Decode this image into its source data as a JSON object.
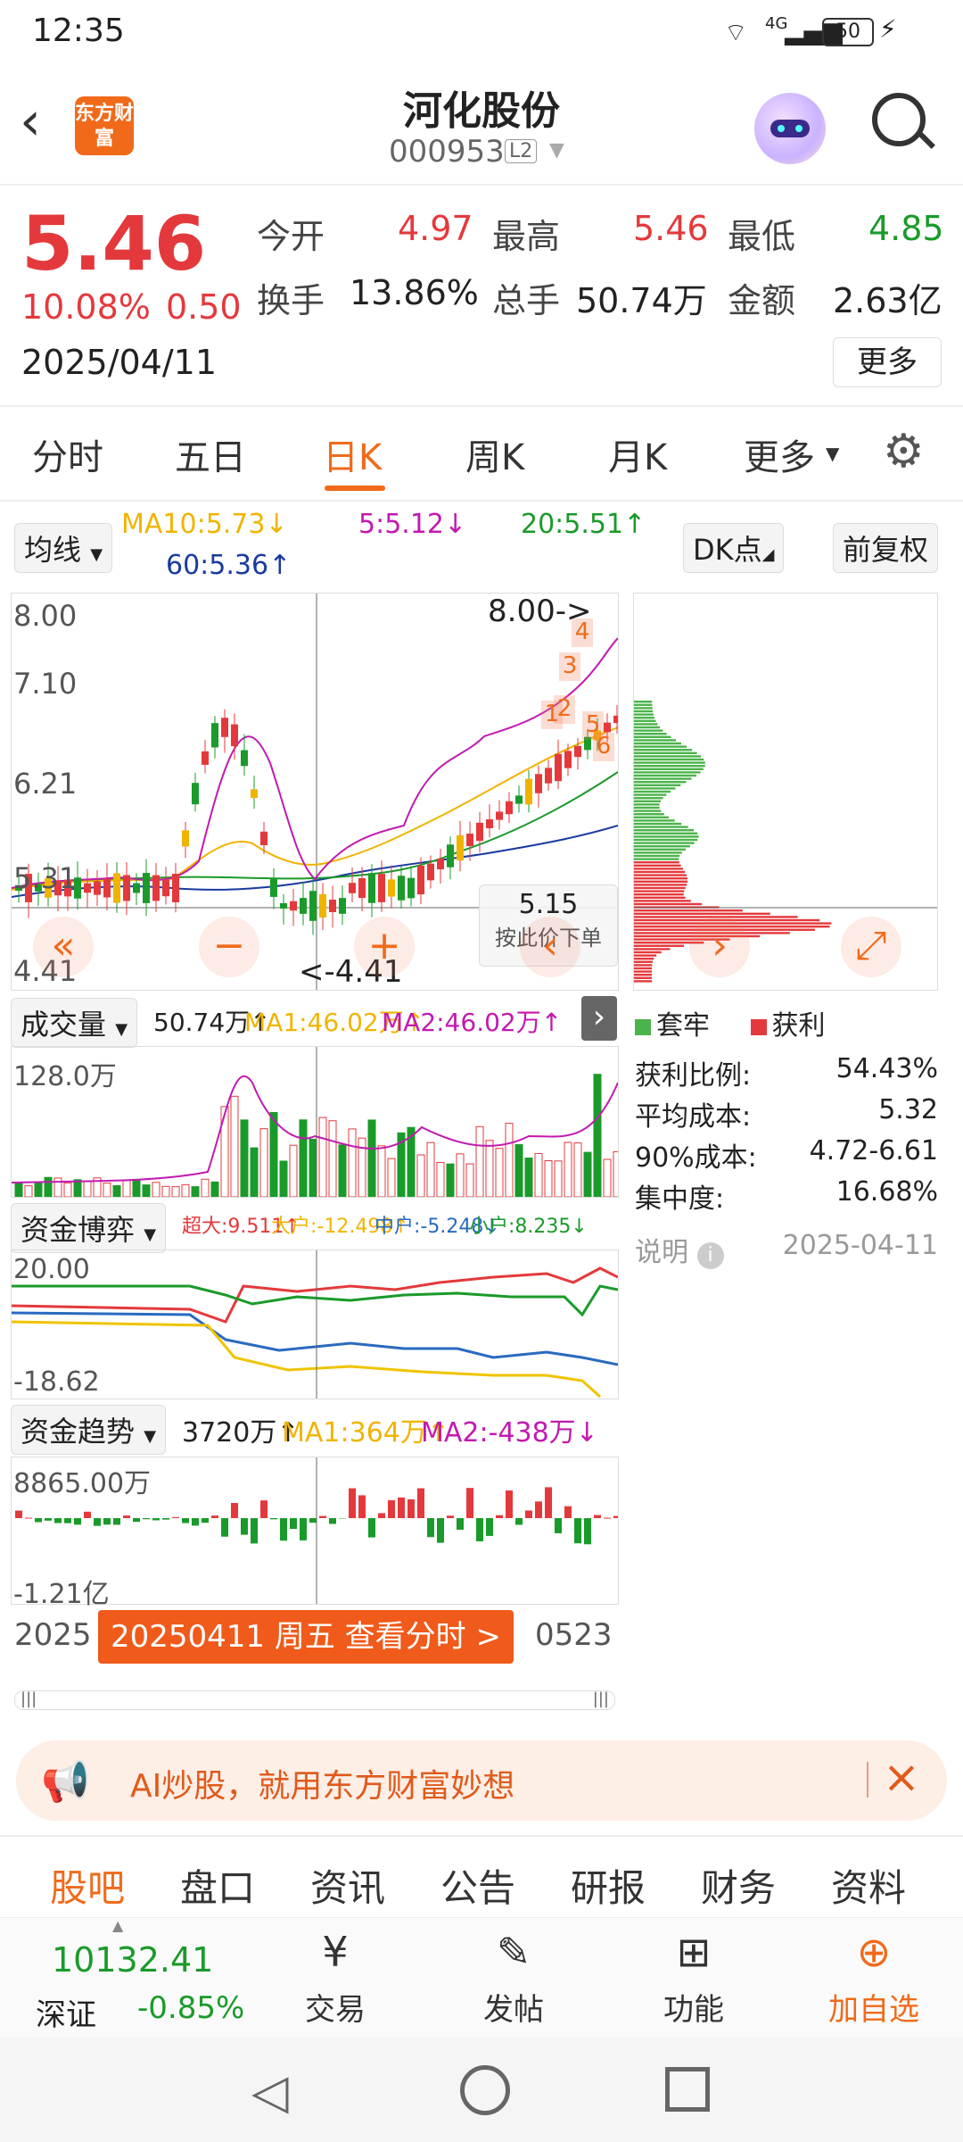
{
  "status_bar": {
    "time": "12:35",
    "network": "4G",
    "battery": "50"
  },
  "header": {
    "stock_name": "河化股份",
    "stock_code": "000953",
    "level_badge": "L2",
    "logo_text": "东方财富"
  },
  "quote": {
    "price": "5.46",
    "change_pct": "10.08%",
    "change": "0.50",
    "date": "2025/04/11",
    "open_label": "今开",
    "open": "4.97",
    "high_label": "最高",
    "high": "5.46",
    "low_label": "最低",
    "low": "4.85",
    "turnover_label": "换手",
    "turnover": "13.86%",
    "volume_label": "总手",
    "volume": "50.74万",
    "amount_label": "金额",
    "amount": "2.63亿",
    "more_button": "更多"
  },
  "tabs": [
    "分时",
    "五日",
    "日K",
    "周K",
    "月K",
    "更多"
  ],
  "chart_toolbar": {
    "ma_select": "均线",
    "ma10": "MA10:5.73↓",
    "ma5": "5:5.12↓",
    "ma20": "20:5.51↑",
    "ma60": "60:5.36↑",
    "dk_button": "DK点",
    "fq_button": "前复权"
  },
  "kline": {
    "y_labels": [
      "8.00",
      "7.10",
      "6.21",
      "5.31",
      "4.41"
    ],
    "max_marker": "8.00->",
    "min_marker": "<-4.41",
    "cursor_price": "5.15",
    "cursor_hint": "按此价下单",
    "signal_labels": [
      "4",
      "3",
      "1",
      "2",
      "5",
      "6"
    ]
  },
  "chip_panel": {
    "legend_locked": "套牢",
    "legend_profit": "获利",
    "rows": [
      {
        "label": "获利比例:",
        "value": "54.43%"
      },
      {
        "label": "平均成本:",
        "value": "5.32"
      },
      {
        "label": "90%成本:",
        "value": "4.72-6.61"
      },
      {
        "label": "集中度:",
        "value": "16.68%"
      }
    ],
    "note_label": "说明",
    "date": "2025-04-11"
  },
  "volume_panel": {
    "select": "成交量",
    "value": "50.74万↑",
    "ma1": "MA1:46.02万↑",
    "ma2": "MA2:46.02万↑",
    "y_label": "128.0万"
  },
  "fund_game_panel": {
    "select": "资金博弈",
    "super": "超大:9.511↑",
    "big": "大户:-12.498↑",
    "mid": "中户:-5.248↓",
    "small": "小户:8.235↓",
    "y_top": "20.00",
    "y_bottom": "-18.62"
  },
  "fund_trend_panel": {
    "select": "资金趋势",
    "value": "3720万↑",
    "ma1": "MA1:364万↑",
    "ma2": "MA2:-438万↓",
    "y_top": "8865.00万",
    "y_bottom": "-1.21亿"
  },
  "x_axis": {
    "left": "2025",
    "right": "0523",
    "tooltip": "20250411 周五 查看分时 >"
  },
  "ad_banner": {
    "text": "AI炒股，就用东方财富妙想"
  },
  "bottom_tabs": [
    "股吧",
    "盘口",
    "资讯",
    "公告",
    "研报",
    "财务",
    "资料"
  ],
  "bottom_nav": {
    "index_value": "10132.41",
    "index_name": "深证",
    "index_change": "-0.85%",
    "items": [
      {
        "label": "交易",
        "icon": "trade-icon"
      },
      {
        "label": "发帖",
        "icon": "post-icon"
      },
      {
        "label": "功能",
        "icon": "function-icon"
      },
      {
        "label": "加自选",
        "icon": "add-watchlist-icon"
      }
    ]
  },
  "colors": {
    "up": "#e4393c",
    "down": "#1a9a2a",
    "accent": "#f06a1a",
    "ma5": "#c21ab0",
    "ma10": "#f0b400",
    "ma20": "#1a9a2a",
    "ma60": "#1a3aa0"
  }
}
